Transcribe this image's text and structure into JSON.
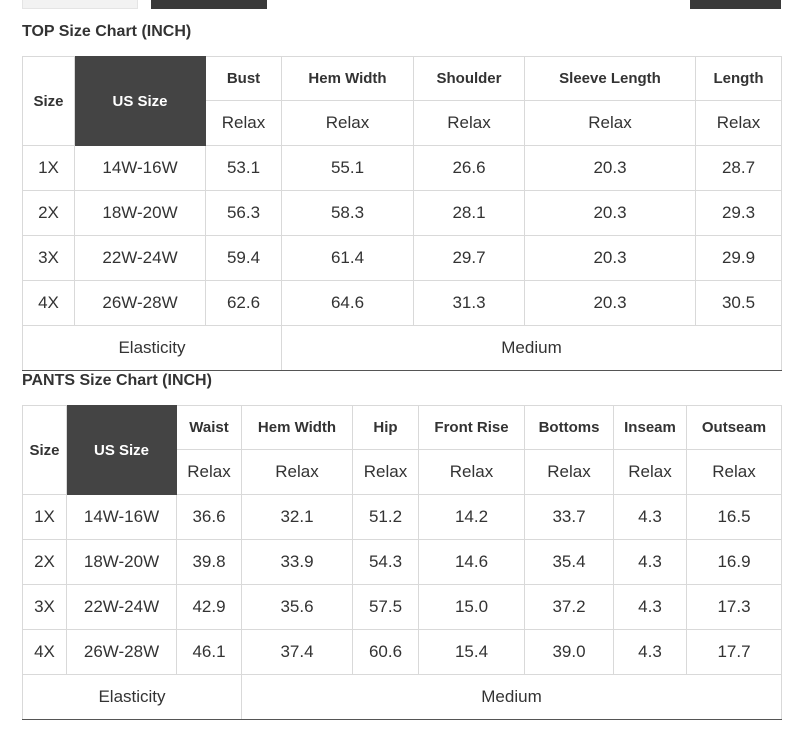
{
  "top_chart": {
    "title": "TOP Size Chart (INCH)",
    "size_label": "Size",
    "us_size_label": "US Size",
    "columns": [
      "Bust",
      "Hem Width",
      "Shoulder",
      "Sleeve Length",
      "Length"
    ],
    "subheaders": [
      "Relax",
      "Relax",
      "Relax",
      "Relax",
      "Relax"
    ],
    "rows": [
      {
        "size": "1X",
        "us": "14W-16W",
        "values": [
          "53.1",
          "55.1",
          "26.6",
          "20.3",
          "28.7"
        ]
      },
      {
        "size": "2X",
        "us": "18W-20W",
        "values": [
          "56.3",
          "58.3",
          "28.1",
          "20.3",
          "29.3"
        ]
      },
      {
        "size": "3X",
        "us": "22W-24W",
        "values": [
          "59.4",
          "61.4",
          "29.7",
          "20.3",
          "29.9"
        ]
      },
      {
        "size": "4X",
        "us": "26W-28W",
        "values": [
          "62.6",
          "64.6",
          "31.3",
          "20.3",
          "30.5"
        ]
      }
    ],
    "footer_label": "Elasticity",
    "footer_value": "Medium"
  },
  "pants_chart": {
    "title": "PANTS Size Chart (INCH)",
    "size_label": "Size",
    "us_size_label": "US Size",
    "columns": [
      "Waist",
      "Hem Width",
      "Hip",
      "Front Rise",
      "Bottoms",
      "Inseam",
      "Outseam"
    ],
    "subheaders": [
      "Relax",
      "Relax",
      "Relax",
      "Relax",
      "Relax",
      "Relax",
      "Relax"
    ],
    "rows": [
      {
        "size": "1X",
        "us": "14W-16W",
        "values": [
          "36.6",
          "32.1",
          "51.2",
          "14.2",
          "33.7",
          "4.3",
          "16.5"
        ]
      },
      {
        "size": "2X",
        "us": "18W-20W",
        "values": [
          "39.8",
          "33.9",
          "54.3",
          "14.6",
          "35.4",
          "4.3",
          "16.9"
        ]
      },
      {
        "size": "3X",
        "us": "22W-24W",
        "values": [
          "42.9",
          "35.6",
          "57.5",
          "15.0",
          "37.2",
          "4.3",
          "17.3"
        ]
      },
      {
        "size": "4X",
        "us": "26W-28W",
        "values": [
          "46.1",
          "37.4",
          "60.6",
          "15.4",
          "39.0",
          "4.3",
          "17.7"
        ]
      }
    ],
    "footer_label": "Elasticity",
    "footer_value": "Medium"
  }
}
